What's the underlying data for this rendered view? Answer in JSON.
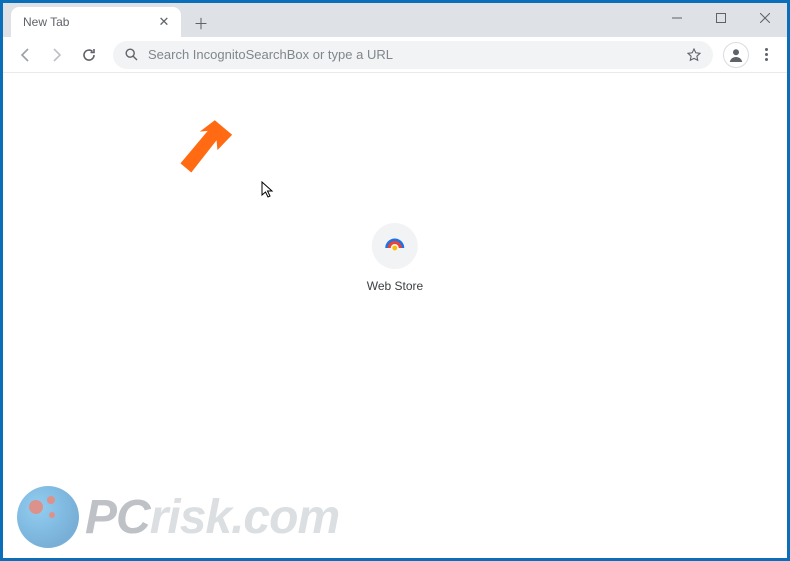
{
  "tab": {
    "title": "New Tab"
  },
  "omnibox": {
    "placeholder": "Search IncognitoSearchBox or type a URL"
  },
  "shortcut": {
    "label": "Web Store"
  },
  "watermark": {
    "part1": "PC",
    "part2": "risk.com"
  }
}
